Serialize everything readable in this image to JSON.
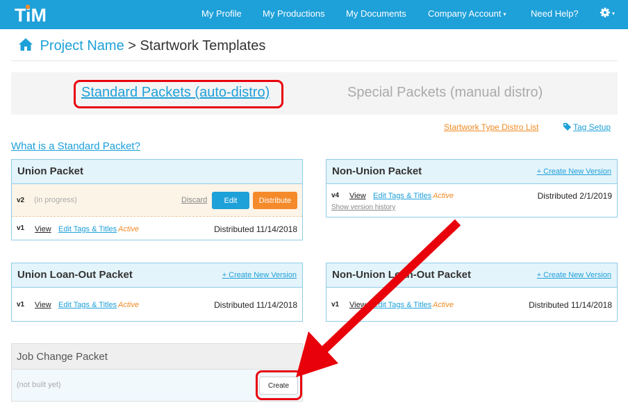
{
  "nav": {
    "logo": "TiM",
    "items": [
      "My Profile",
      "My Productions",
      "My Documents",
      "Company Account",
      "Need Help?"
    ],
    "caret": "▾",
    "colors": {
      "bar": "#1ea0d9",
      "accent_orange": "#f58a2a",
      "annotation_red": "#e8000b"
    }
  },
  "breadcrumb": {
    "project": "Project Name",
    "separator": ">",
    "page": "Startwork Templates"
  },
  "tabs": {
    "standard": "Standard Packets (auto-distro)",
    "special": "Special Packets (manual distro)"
  },
  "links": {
    "distro_list": "Startwork Type Distro List",
    "tag_setup": "Tag Setup",
    "what_is": "What is a Standard Packet?"
  },
  "common": {
    "view": "View",
    "edit_tags": "Edit Tags & Titles",
    "active": "Active",
    "create_version": "+ Create New Version"
  },
  "union": {
    "title": "Union Packet",
    "draft_version": "v2",
    "draft_status": "(in progress)",
    "discard": "Discard",
    "edit": "Edit",
    "distribute": "Distribute",
    "version": "v1",
    "distributed": "Distributed 11/14/2018"
  },
  "nonunion": {
    "title": "Non-Union Packet",
    "version": "v4",
    "distributed": "Distributed 2/1/2019",
    "history": "Show version history"
  },
  "union_loanout": {
    "title": "Union Loan-Out Packet",
    "version": "v1",
    "distributed": "Distributed 11/14/2018"
  },
  "nonunion_loanout": {
    "title": "Non-Union Loan-Out Packet",
    "version": "v1",
    "distributed": "Distributed 11/14/2018"
  },
  "job_change": {
    "title": "Job Change Packet",
    "status": "(not built yet)",
    "create": "Create"
  }
}
